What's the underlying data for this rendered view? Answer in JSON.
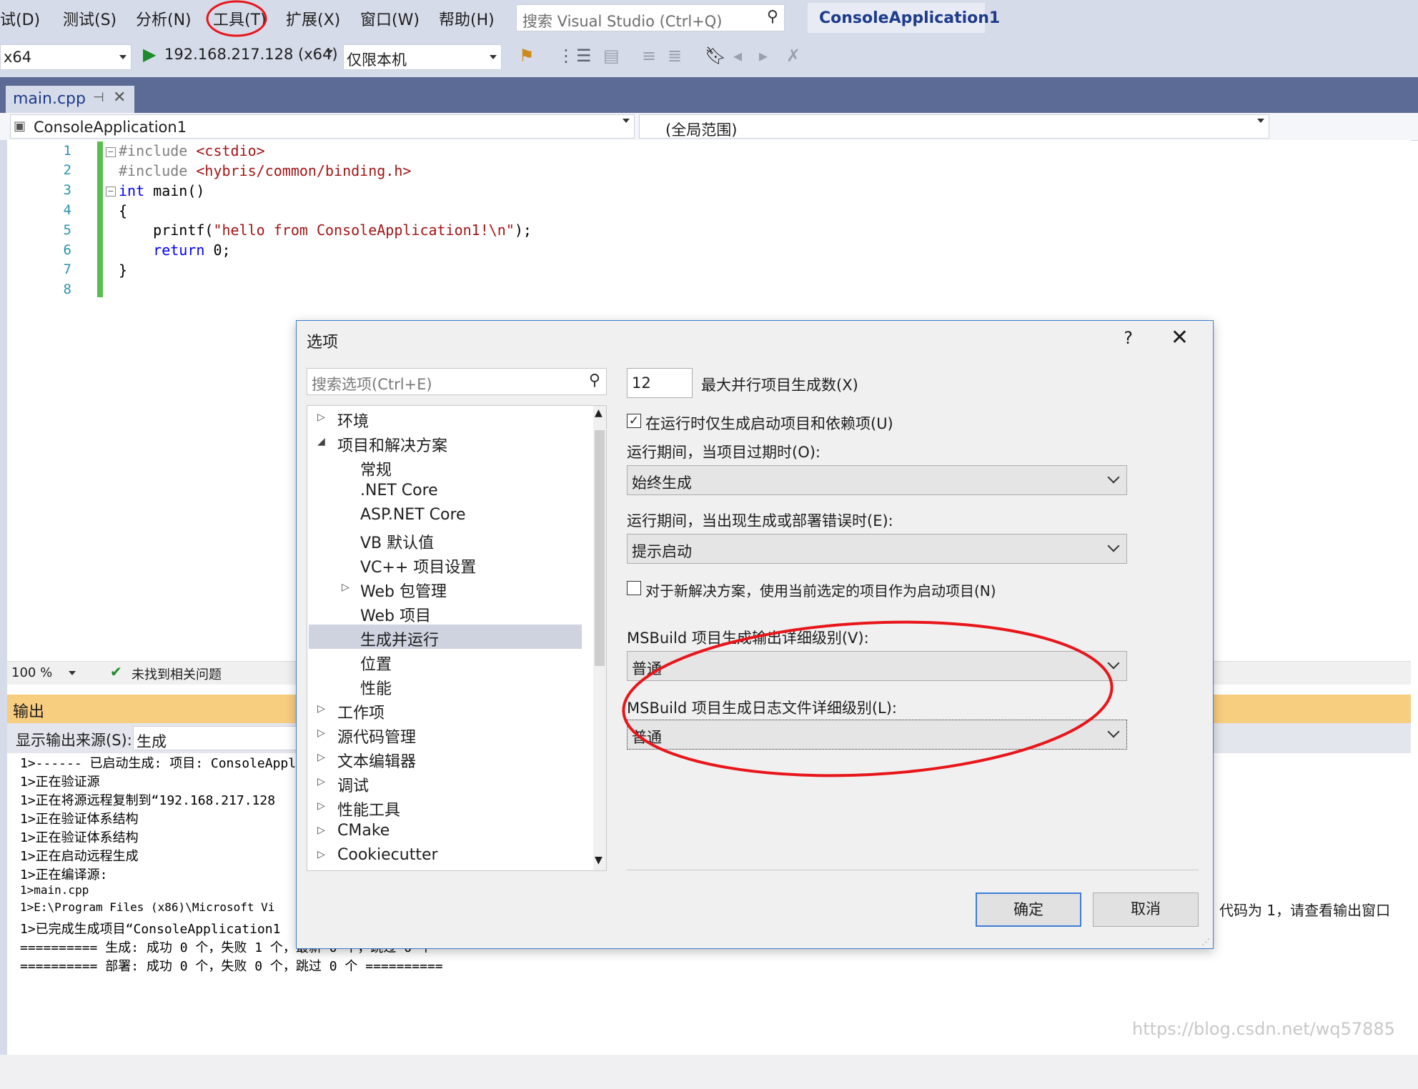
{
  "menu": {
    "items": [
      "试(D)",
      "测试(S)",
      "分析(N)",
      "工具(T)",
      "扩展(X)",
      "窗口(W)",
      "帮助(H)"
    ]
  },
  "search": {
    "placeholder": "搜索 Visual Studio (Ctrl+Q)"
  },
  "window_title": "ConsoleApplication1",
  "toolbar": {
    "platform": "x64",
    "remote_target": "192.168.217.128 (x64)",
    "scope": "仅限本机"
  },
  "editor": {
    "tab_label": "main.cpp",
    "project_combo": "ConsoleApplication1",
    "scope_combo": "(全局范围)",
    "line_numbers": [
      "1",
      "2",
      "3",
      "4",
      "5",
      "6",
      "7",
      "8"
    ],
    "code": {
      "l1_kw": "#include",
      "l1_rest": " <cstdio>",
      "l2_kw": "#include",
      "l2_rest": " <hybris/common/binding.h>",
      "l3_kw": "int",
      "l3_rest": " main()",
      "l4": "{",
      "l5_a": "    printf(",
      "l5_str": "\"hello from ConsoleApplication1!\\n\"",
      "l5_b": ");",
      "l6_kw": "    return",
      "l6_rest": " 0;",
      "l7": "}"
    },
    "zoom": "100 %",
    "issues": "未找到相关问题"
  },
  "output": {
    "title": "输出",
    "source_label": "显示输出来源(S):",
    "source_value": "生成",
    "lines": [
      "1>------ 已启动生成: 项目: ConsoleAppl",
      "1>正在验证源",
      "1>正在将源远程复制到“192.168.217.128",
      "1>正在验证体系结构",
      "1>正在验证体系结构",
      "1>正在启动远程生成",
      "1>正在编译源:",
      "1>main.cpp",
      "1>E:\\Program Files (x86)\\Microsoft Vi",
      "1>已完成生成项目“ConsoleApplication1",
      "========== 生成: 成功 0 个，失败 1 个，最新 0 个，跳过 0 个",
      "========== 部署: 成功 0 个，失败 0 个，跳过 0 个 =========="
    ],
    "right_tail": "代码为 1，请查看输出窗口"
  },
  "dialog": {
    "title": "选项",
    "help": "?",
    "close": "✕",
    "search_placeholder": "搜索选项(Ctrl+E)",
    "tree": [
      {
        "label": "环境",
        "expander": "collapsed"
      },
      {
        "label": "项目和解决方案",
        "expander": "expanded"
      },
      {
        "label": "常规"
      },
      {
        "label": ".NET Core"
      },
      {
        "label": "ASP.NET Core"
      },
      {
        "label": "VB 默认值"
      },
      {
        "label": "VC++ 项目设置"
      },
      {
        "label": "Web 包管理",
        "expander": "collapsed"
      },
      {
        "label": "Web 项目"
      },
      {
        "label": "生成并运行",
        "selected": true
      },
      {
        "label": "位置"
      },
      {
        "label": "性能"
      },
      {
        "label": "工作项",
        "expander": "collapsed"
      },
      {
        "label": "源代码管理",
        "expander": "collapsed"
      },
      {
        "label": "文本编辑器",
        "expander": "collapsed"
      },
      {
        "label": "调试",
        "expander": "collapsed"
      },
      {
        "label": "性能工具",
        "expander": "collapsed"
      },
      {
        "label": "CMake",
        "expander": "collapsed"
      },
      {
        "label": "Cookiecutter",
        "expander": "collapsed"
      }
    ],
    "max_parallel_value": "12",
    "max_parallel_label": "最大并行项目生成数(X)",
    "only_build_startup_label": "在运行时仅生成启动项目和依赖项(U)",
    "only_build_startup_checked": true,
    "out_of_date_label": "运行期间，当项目过期时(O):",
    "out_of_date_value": "始终生成",
    "build_error_label": "运行期间，当出现生成或部署错误时(E):",
    "build_error_value": "提示启动",
    "new_solution_label": "对于新解决方案，使用当前选定的项目作为启动项目(N)",
    "new_solution_checked": false,
    "msbuild_output_label": "MSBuild 项目生成输出详细级别(V):",
    "msbuild_output_value": "普通",
    "msbuild_log_label": "MSBuild 项目生成日志文件详细级别(L):",
    "msbuild_log_value": "普通",
    "ok": "确定",
    "cancel": "取消"
  },
  "watermark": "https://blog.csdn.net/wq57885",
  "colors": {
    "annotation": "#e8161b",
    "accent": "#3c7dd8",
    "output_header": "#f7cd80"
  }
}
